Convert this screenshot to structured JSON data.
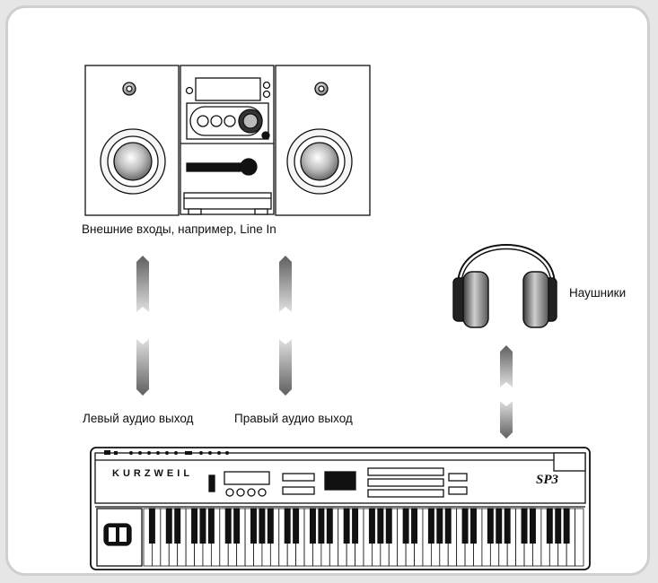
{
  "labels": {
    "external_inputs": "Внешние входы, например, Line In",
    "left_out": "Левый аудио выход",
    "right_out": "Правый аудио выход",
    "headphones": "Наушники"
  },
  "keyboard": {
    "brand": "KURZWEIL",
    "model": "SP3"
  },
  "colors": {
    "arrow_dark": "#6f6f6f",
    "arrow_light": "#d6d6d6",
    "outline": "#111111",
    "frame": "#cfcfcf"
  }
}
